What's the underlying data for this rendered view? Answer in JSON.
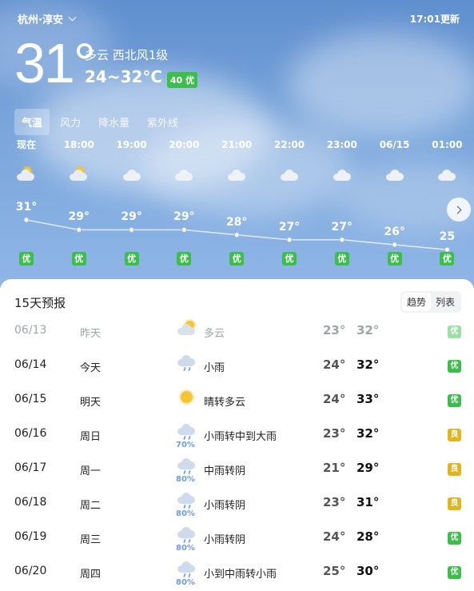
{
  "header": {
    "location": "杭州·淳安",
    "update_time": "17:01更新"
  },
  "current": {
    "temperature": "31°",
    "description": "多云 西北风1级",
    "range": "24~32°C",
    "aqi_label": "40 优"
  },
  "tabs": [
    "气温",
    "风力",
    "降水量",
    "紫外线"
  ],
  "active_tab": "气温",
  "hourly": [
    {
      "time": "现在",
      "icon": "partly-cloudy-icon",
      "temp": "31°",
      "temp_value": 31,
      "aqi": "优"
    },
    {
      "time": "18:00",
      "icon": "partly-cloudy-icon",
      "temp": "29°",
      "temp_value": 29,
      "aqi": "优"
    },
    {
      "time": "19:00",
      "icon": "cloudy-icon",
      "temp": "29°",
      "temp_value": 29,
      "aqi": "优"
    },
    {
      "time": "20:00",
      "icon": "cloudy-icon",
      "temp": "29°",
      "temp_value": 29,
      "aqi": "优"
    },
    {
      "time": "21:00",
      "icon": "cloudy-icon",
      "temp": "28°",
      "temp_value": 28,
      "aqi": "优"
    },
    {
      "time": "22:00",
      "icon": "cloudy-icon",
      "temp": "27°",
      "temp_value": 27,
      "aqi": "优"
    },
    {
      "time": "23:00",
      "icon": "cloudy-icon",
      "temp": "27°",
      "temp_value": 27,
      "aqi": "优"
    },
    {
      "time": "06/15",
      "icon": "cloudy-icon",
      "temp": "26°",
      "temp_value": 26,
      "aqi": "优"
    },
    {
      "time": "01:00",
      "icon": "cloudy-icon",
      "temp": "25",
      "temp_value": 25,
      "aqi": "优"
    }
  ],
  "forecast": {
    "title": "15天预报",
    "view_options": [
      "趋势",
      "列表"
    ],
    "active_view": "趋势",
    "days": [
      {
        "date": "06/13",
        "week": "昨天",
        "icon": "cloudy-sun-icon",
        "pop": "",
        "desc": "多云",
        "low": "23°",
        "high": "32°",
        "aqi": "优",
        "aqi_level": "good",
        "past": true
      },
      {
        "date": "06/14",
        "week": "今天",
        "icon": "rain-icon",
        "pop": "",
        "desc": "小雨",
        "low": "24°",
        "high": "32°",
        "aqi": "优",
        "aqi_level": "good",
        "past": false
      },
      {
        "date": "06/15",
        "week": "明天",
        "icon": "sun-icon",
        "pop": "",
        "desc": "晴转多云",
        "low": "24°",
        "high": "33°",
        "aqi": "优",
        "aqi_level": "good",
        "past": false
      },
      {
        "date": "06/16",
        "week": "周日",
        "icon": "rain-icon",
        "pop": "70%",
        "desc": "小雨转中到大雨",
        "low": "23°",
        "high": "32°",
        "aqi": "良",
        "aqi_level": "fair",
        "past": false
      },
      {
        "date": "06/17",
        "week": "周一",
        "icon": "rain-icon",
        "pop": "80%",
        "desc": "中雨转阴",
        "low": "21°",
        "high": "29°",
        "aqi": "良",
        "aqi_level": "fair",
        "past": false
      },
      {
        "date": "06/18",
        "week": "周二",
        "icon": "rain-icon",
        "pop": "80%",
        "desc": "小雨转阴",
        "low": "23°",
        "high": "31°",
        "aqi": "良",
        "aqi_level": "fair",
        "past": false
      },
      {
        "date": "06/19",
        "week": "周三",
        "icon": "rain-icon",
        "pop": "80%",
        "desc": "小雨转阴",
        "low": "24°",
        "high": "28°",
        "aqi": "优",
        "aqi_level": "good",
        "past": false
      },
      {
        "date": "06/20",
        "week": "周四",
        "icon": "rain-icon",
        "pop": "80%",
        "desc": "小到中雨转小雨",
        "low": "25°",
        "high": "30°",
        "aqi": "优",
        "aqi_level": "good",
        "past": false
      }
    ]
  },
  "colors": {
    "aqi_good": "#3bbf4a",
    "aqi_fair": "#e1b31e",
    "pop_text": "#6f9be0"
  }
}
